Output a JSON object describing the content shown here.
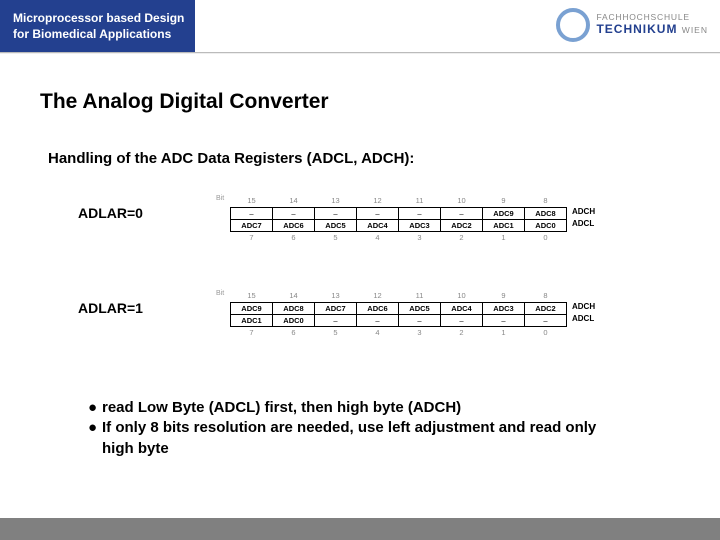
{
  "header": {
    "course_line1": "Microprocessor based Design",
    "course_line2": "for Biomedical Applications",
    "logo_small1": "FACHHOCHSCHULE",
    "logo_big": "TECHNIKUM",
    "logo_small2": "WIEN"
  },
  "title": "The Analog Digital Converter",
  "subtitle": "Handling of the ADC Data Registers (ADCL, ADCH):",
  "mode0": "ADLAR=0",
  "mode1": "ADLAR=1",
  "bit_tag": "Bit",
  "reg_name_h": "ADCH",
  "reg_name_l": "ADCL",
  "t0": {
    "bits_top": [
      "15",
      "14",
      "13",
      "12",
      "11",
      "10",
      "9",
      "8"
    ],
    "row_h": [
      "–",
      "–",
      "–",
      "–",
      "–",
      "–",
      "ADC9",
      "ADC8"
    ],
    "row_l": [
      "ADC7",
      "ADC6",
      "ADC5",
      "ADC4",
      "ADC3",
      "ADC2",
      "ADC1",
      "ADC0"
    ],
    "bits_bot": [
      "7",
      "6",
      "5",
      "4",
      "3",
      "2",
      "1",
      "0"
    ]
  },
  "t1": {
    "bits_top": [
      "15",
      "14",
      "13",
      "12",
      "11",
      "10",
      "9",
      "8"
    ],
    "row_h": [
      "ADC9",
      "ADC8",
      "ADC7",
      "ADC6",
      "ADC5",
      "ADC4",
      "ADC3",
      "ADC2"
    ],
    "row_l": [
      "ADC1",
      "ADC0",
      "–",
      "–",
      "–",
      "–",
      "–",
      "–"
    ],
    "bits_bot": [
      "7",
      "6",
      "5",
      "4",
      "3",
      "2",
      "1",
      "0"
    ]
  },
  "bullets": {
    "dot": "●",
    "b1": "read Low Byte (ADCL) first, then high byte (ADCH)",
    "b2": "If only 8 bits resolution are needed, use left adjustment and read only high byte"
  }
}
